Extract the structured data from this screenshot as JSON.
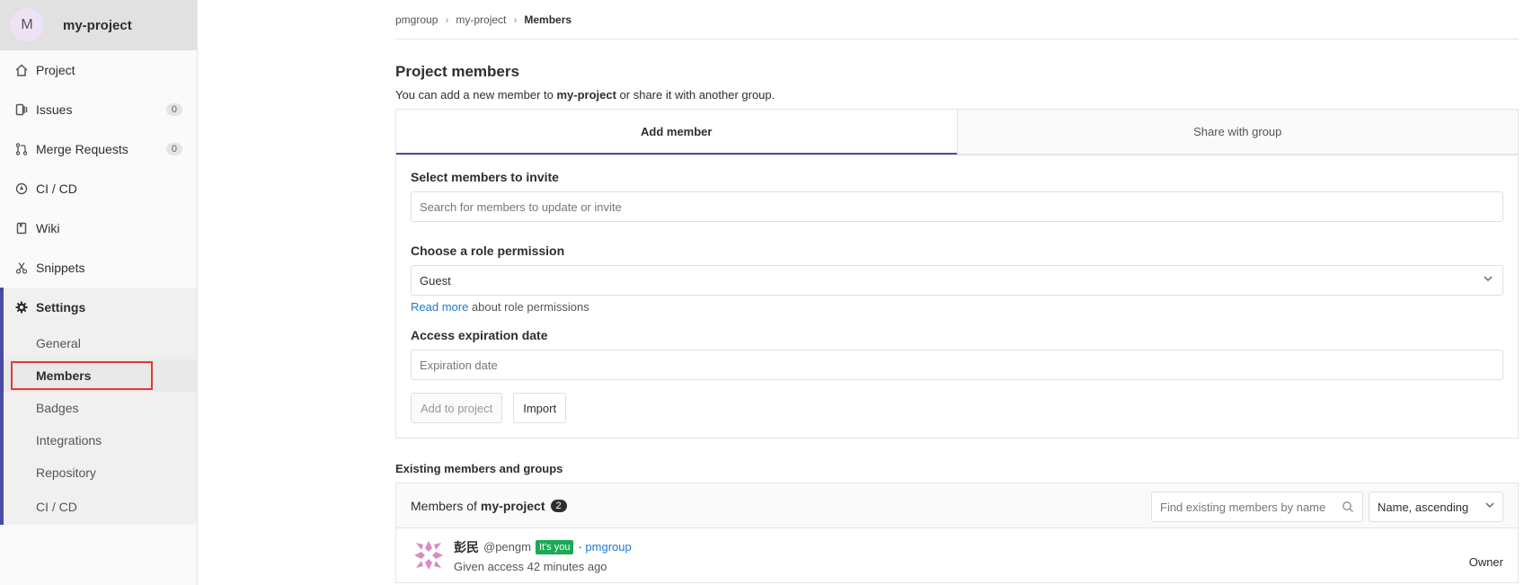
{
  "sidebar": {
    "project_initial": "M",
    "project_name": "my-project",
    "items": [
      {
        "label": "Project",
        "icon": "home-icon"
      },
      {
        "label": "Issues",
        "icon": "issues-icon",
        "count": "0"
      },
      {
        "label": "Merge Requests",
        "icon": "merge-request-icon",
        "count": "0"
      },
      {
        "label": "CI / CD",
        "icon": "rocket-icon"
      },
      {
        "label": "Wiki",
        "icon": "book-icon"
      },
      {
        "label": "Snippets",
        "icon": "scissors-icon"
      }
    ],
    "settings": {
      "label": "Settings",
      "icon": "gear-icon",
      "sub_items": [
        "General",
        "Members",
        "Badges",
        "Integrations",
        "Repository",
        "CI / CD"
      ],
      "active": "Members"
    }
  },
  "breadcrumb": {
    "group": "pmgroup",
    "project": "my-project",
    "current": "Members"
  },
  "page": {
    "title": "Project members",
    "desc_prefix": "You can add a new member to ",
    "desc_project": "my-project",
    "desc_suffix": " or share it with another group."
  },
  "tabs": {
    "add_member": "Add member",
    "share_group": "Share with group"
  },
  "form": {
    "select_label": "Select members to invite",
    "select_placeholder": "Search for members to update or invite",
    "role_label": "Choose a role permission",
    "role_value": "Guest",
    "read_more": "Read more",
    "read_more_suffix": " about role permissions",
    "expiry_label": "Access expiration date",
    "expiry_placeholder": "Expiration date",
    "add_button": "Add to project",
    "import_button": "Import"
  },
  "existing": {
    "title": "Existing members and groups",
    "members_of": "Members of ",
    "project": "my-project",
    "count": "2",
    "search_placeholder": "Find existing members by name",
    "sort_value": "Name, ascending"
  },
  "members": [
    {
      "name": "彭民",
      "username": "@pengm",
      "badge": "It's you",
      "group_prefix": " · ",
      "group": "pmgroup",
      "access": "Given access 42 minutes ago",
      "role": "Owner"
    }
  ]
}
